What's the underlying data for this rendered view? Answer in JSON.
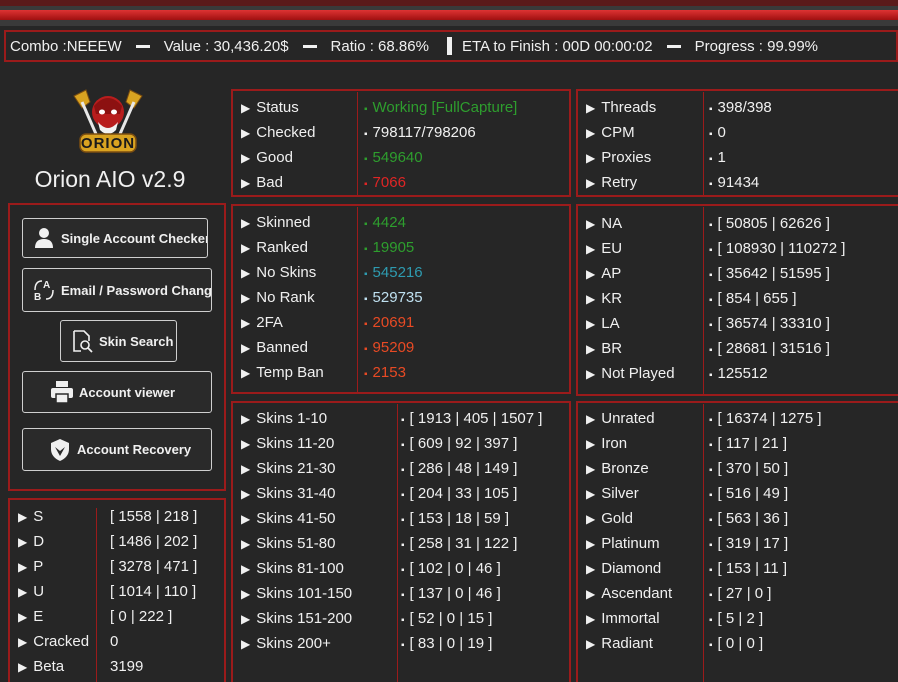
{
  "statusline": {
    "combo": "Combo :NEEEW",
    "value": "Value : 30,436.20$",
    "ratio": "Ratio : 68.86%",
    "eta": "ETA to Finish : 00D 00:00:02",
    "progress": "Progress : 99.99%"
  },
  "app": {
    "title": "Orion AIO v2.9",
    "logo_text": "ORION"
  },
  "buttons": {
    "single": "Single Account Checker",
    "email": "Email / Password Change",
    "skin": "Skin Search",
    "viewer": "Account viewer",
    "recovery": "Account Recovery"
  },
  "status_panel": [
    {
      "label": "Status",
      "value": "Working [FullCapture]",
      "color": "#2e9e2e"
    },
    {
      "label": "Checked",
      "value": "798117/798206",
      "color": "#f0f0f0"
    },
    {
      "label": "Good",
      "value": "549640",
      "color": "#2e9e2e"
    },
    {
      "label": "Bad",
      "value": "7066",
      "color": "#e02525"
    }
  ],
  "threads_panel": [
    {
      "label": "Threads",
      "value": "398/398"
    },
    {
      "label": "CPM",
      "value": "0"
    },
    {
      "label": "Proxies",
      "value": "1"
    },
    {
      "label": "Retry",
      "value": "91434"
    }
  ],
  "skins_panel": [
    {
      "label": "Skinned",
      "value": "4424",
      "color": "#2e9e2e"
    },
    {
      "label": "Ranked",
      "value": "19905",
      "color": "#2e9e2e"
    },
    {
      "label": "No Skins",
      "value": "545216",
      "color": "#2e9bb0"
    },
    {
      "label": "No Rank",
      "value": "529735",
      "color": "#bfe0f0"
    },
    {
      "label": "2FA",
      "value": "20691",
      "color": "#e84a24"
    },
    {
      "label": "Banned",
      "value": "95209",
      "color": "#e84a24"
    },
    {
      "label": "Temp Ban",
      "value": "2153",
      "color": "#e84a24"
    }
  ],
  "region_panel": [
    {
      "label": "NA",
      "value": "[ 50805 | 62626 ]"
    },
    {
      "label": "EU",
      "value": "[ 108930 | 110272 ]"
    },
    {
      "label": "AP",
      "value": "[ 35642 | 51595 ]"
    },
    {
      "label": "KR",
      "value": "[ 854 | 655 ]"
    },
    {
      "label": "LA",
      "value": "[ 36574 | 33310 ]"
    },
    {
      "label": "BR",
      "value": "[ 28681 | 31516 ]"
    },
    {
      "label": "Not Played",
      "value": "125512"
    }
  ],
  "skin_counts_panel": [
    {
      "label": "Skins 1-10",
      "value": "[ 1913 | 405 | 1507 ]"
    },
    {
      "label": "Skins 11-20",
      "value": "[ 609 | 92 | 397 ]"
    },
    {
      "label": "Skins 21-30",
      "value": "[ 286 | 48 | 149 ]"
    },
    {
      "label": "Skins 31-40",
      "value": "[ 204 | 33 | 105 ]"
    },
    {
      "label": "Skins 41-50",
      "value": "[ 153 | 18 | 59 ]"
    },
    {
      "label": "Skins 51-80",
      "value": "[ 258 | 31 | 122 ]"
    },
    {
      "label": "Skins 81-100",
      "value": "[ 102 | 0 | 46 ]"
    },
    {
      "label": "Skins 101-150",
      "value": "[ 137 | 0 | 46 ]"
    },
    {
      "label": "Skins 151-200",
      "value": "[ 52 | 0 | 15 ]"
    },
    {
      "label": "Skins 200+",
      "value": "[ 83 | 0 | 19 ]"
    }
  ],
  "rank_panel": [
    {
      "label": "Unrated",
      "value": "[ 16374 | 1275 ]"
    },
    {
      "label": "Iron",
      "value": "[ 117 | 21 ]"
    },
    {
      "label": "Bronze",
      "value": "[ 370 | 50 ]"
    },
    {
      "label": "Silver",
      "value": "[ 516 | 49 ]"
    },
    {
      "label": "Gold",
      "value": "[ 563 | 36 ]"
    },
    {
      "label": "Platinum",
      "value": "[ 319 | 17 ]"
    },
    {
      "label": "Diamond",
      "value": "[ 153 | 11 ]"
    },
    {
      "label": "Ascendant",
      "value": "[ 27 | 0 ]"
    },
    {
      "label": "Immortal",
      "value": "[ 5 | 2 ]"
    },
    {
      "label": "Radiant",
      "value": "[ 0 | 0 ]"
    }
  ],
  "letter_panel": [
    {
      "label": "S",
      "value": "[ 1558 | 218 ]"
    },
    {
      "label": "D",
      "value": "[ 1486 | 202 ]"
    },
    {
      "label": "P",
      "value": "[ 3278 | 471 ]"
    },
    {
      "label": "U",
      "value": "[ 1014 | 110 ]"
    },
    {
      "label": "E",
      "value": "[ 0 | 222 ]"
    },
    {
      "label": "Cracked",
      "value": "0"
    },
    {
      "label": "Beta",
      "value": "3199"
    }
  ],
  "colors": {
    "accent": "#9b1b1b",
    "background": "#262626"
  }
}
